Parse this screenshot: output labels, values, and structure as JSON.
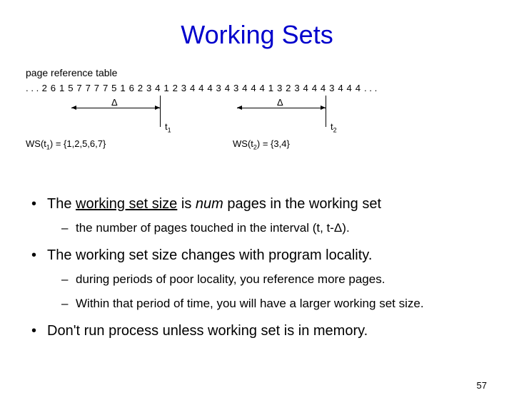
{
  "title": "Working Sets",
  "figure": {
    "caption": "page reference table",
    "ref_leading_dots": ". . .",
    "ref_string": "2 6 1 5 7 7 7 7 5 1 6 2 3 4 1 2 3 4 4 4 3 4 3 4 4 4 1 3 2 3 4 4 4 3 4 4 4",
    "ref_trailing_dots": ". . .",
    "delta1": "Δ",
    "delta2": "Δ",
    "t1": "t",
    "t1_sub": "1",
    "t2": "t",
    "t2_sub": "2",
    "ws1_pre": "WS(t",
    "ws1_sub": "1",
    "ws1_post": ") = {1,2,5,6,7}",
    "ws2_pre": "WS(t",
    "ws2_sub": "2",
    "ws2_post": ") = {3,4}"
  },
  "bullets": {
    "b1_pre": "The ",
    "b1_u": "working set size",
    "b1_mid": " is ",
    "b1_it": "num",
    "b1_post": " pages in the working set",
    "b1_s1": "the number of pages touched in the interval (t, t-Δ).",
    "b2": "The working set size changes with program locality.",
    "b2_s1": "during periods of poor locality, you reference more pages.",
    "b2_s2": "Within that period of time, you will have a larger working set size.",
    "b3": "Don't run process unless working set is in memory."
  },
  "page_number": "57"
}
